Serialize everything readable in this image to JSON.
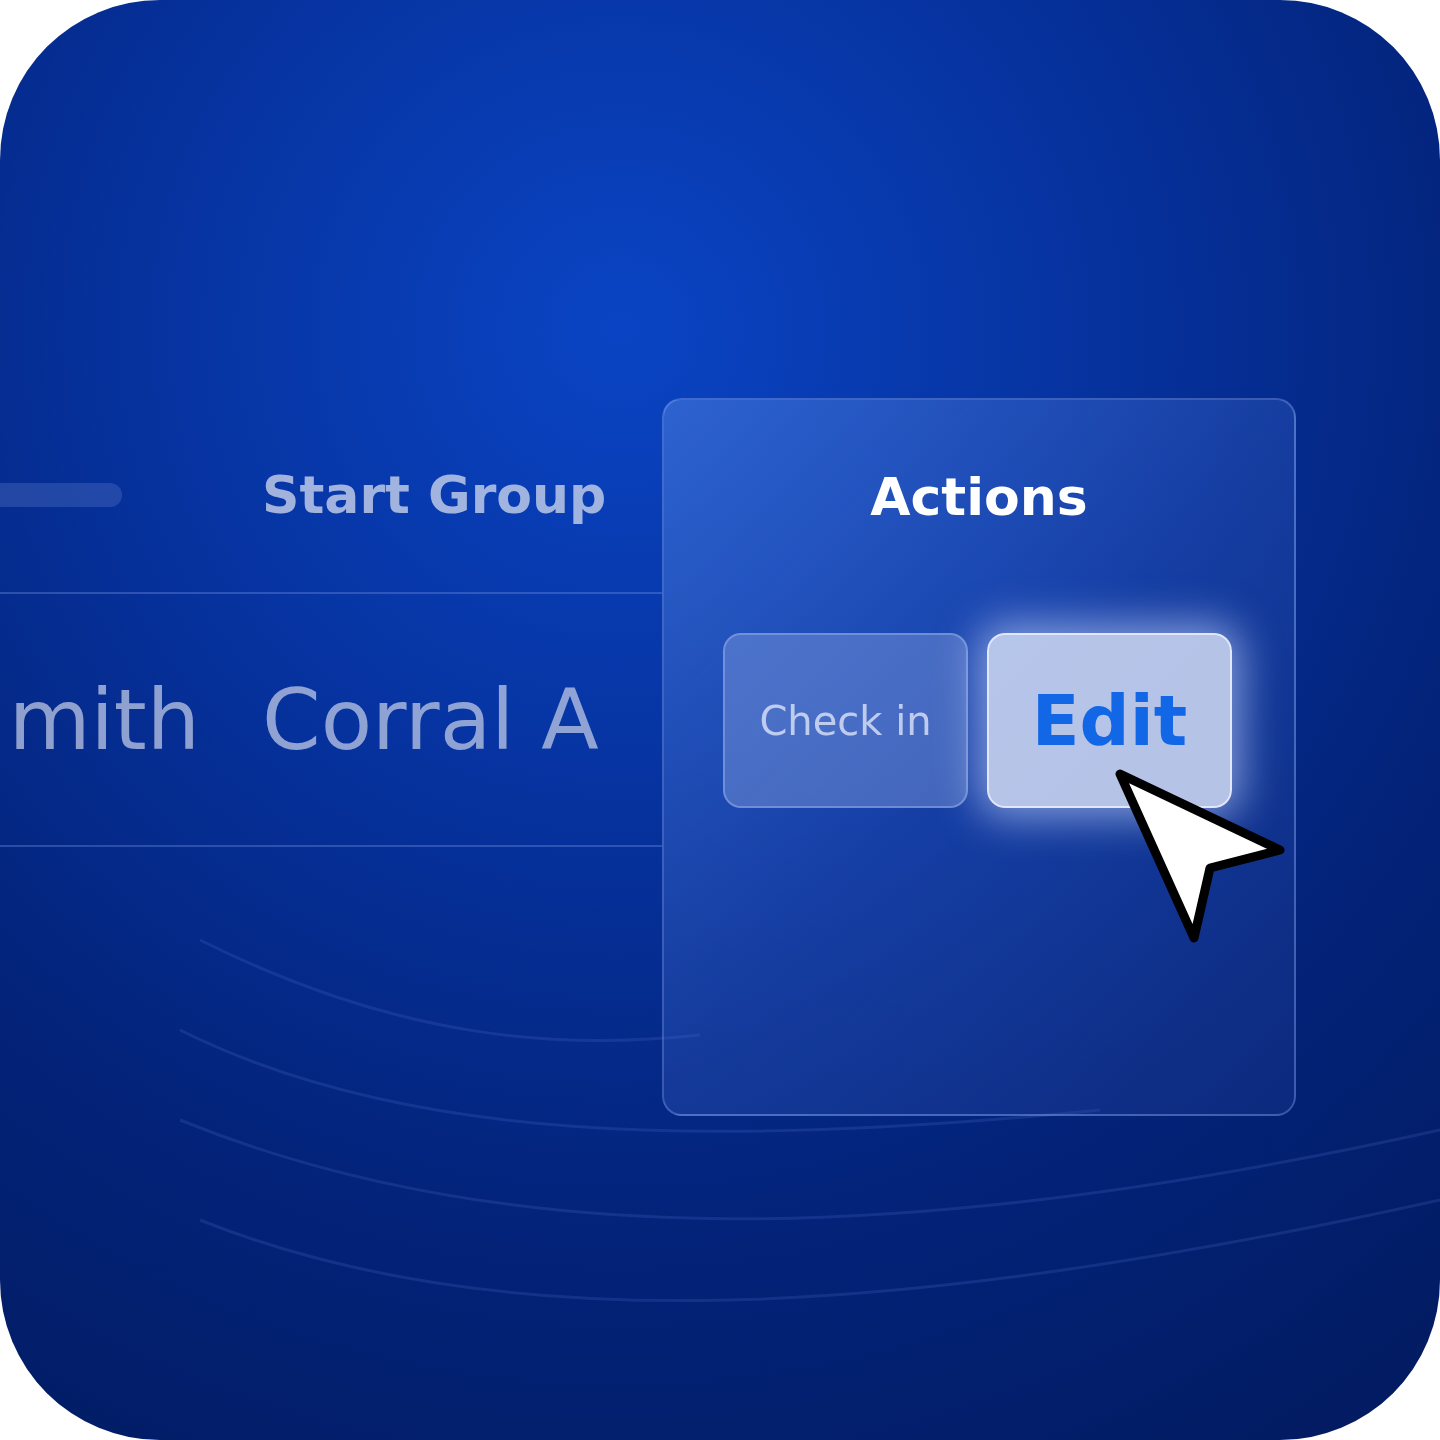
{
  "table": {
    "columns": [
      {
        "kind": "placeholder"
      },
      {
        "kind": "text",
        "label": "Start Group"
      },
      {
        "kind": "text",
        "label": "Actions"
      }
    ],
    "rows": [
      {
        "cells": [
          "mith",
          "Corral A"
        ],
        "actions": [
          {
            "label": "Check in",
            "hovered": false
          },
          {
            "label": "Edit",
            "hovered": true
          }
        ]
      }
    ]
  }
}
